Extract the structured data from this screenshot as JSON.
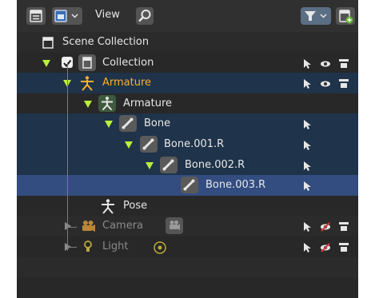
{
  "header": {
    "view_label": "View",
    "buttons": [
      "display-mode-button",
      "filter-button",
      "new-collection-button"
    ]
  },
  "rows": {
    "scene_collection": "Scene Collection",
    "collection": "Collection",
    "armature_object": "Armature",
    "armature_data": "Armature",
    "bone": "Bone",
    "bone_001": "Bone.001.R",
    "bone_002": "Bone.002.R",
    "bone_003": "Bone.003.R",
    "pose": "Pose",
    "camera": "Camera",
    "light": "Light"
  },
  "colors": {
    "active_object": "#ffaf29",
    "disclosure": "#b8f03c",
    "selected_row": "#1f334a",
    "active_row": "#334d80"
  }
}
